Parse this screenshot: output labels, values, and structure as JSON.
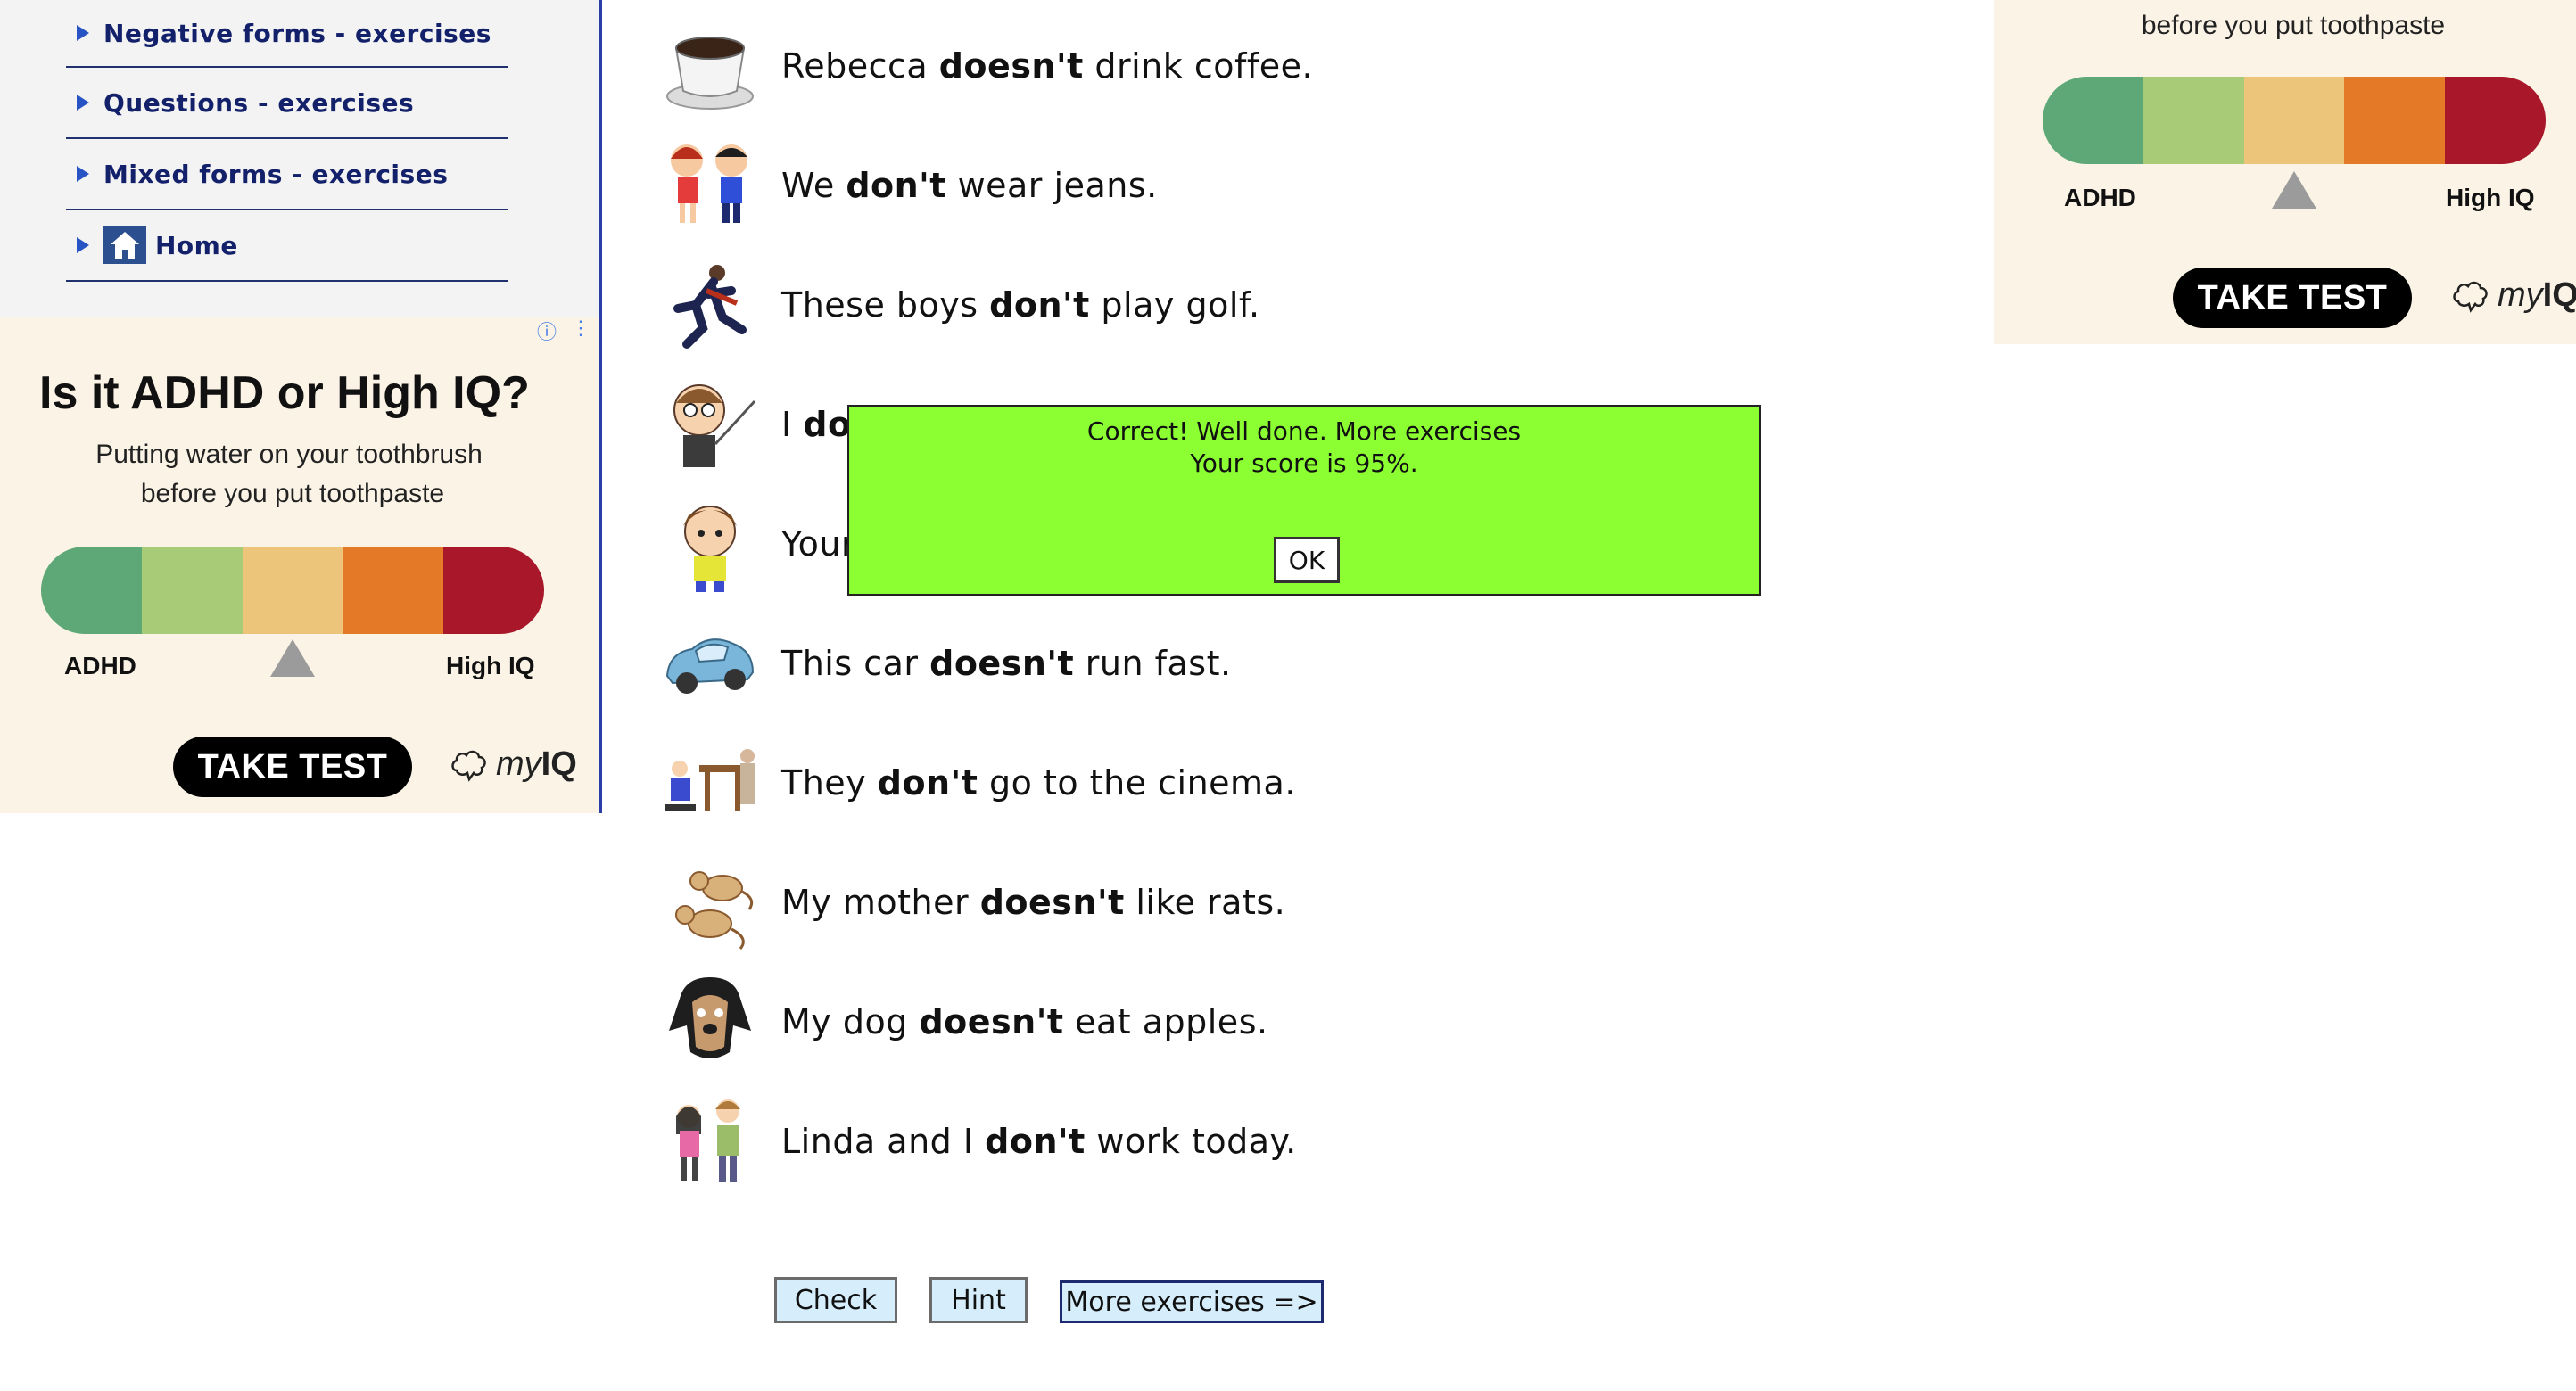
{
  "sidebar": {
    "items": [
      {
        "label": "Negative forms - exercises"
      },
      {
        "label": "Questions - exercises"
      },
      {
        "label": "Mixed forms - exercises"
      },
      {
        "label": "Home"
      }
    ]
  },
  "ad_left": {
    "title": "Is it ADHD or High IQ?",
    "subtitle_line1": "Putting water on your toothbrush",
    "subtitle_line2": "before you put toothpaste",
    "label_left": "ADHD",
    "label_right": "High IQ",
    "cta": "TAKE TEST",
    "brand_prefix": "my",
    "brand_suffix": "IQ",
    "info_icon": "ⓘ",
    "menu_icon": "⋮"
  },
  "ad_right": {
    "subtitle_line2": "before you put toothpaste",
    "label_left": "ADHD",
    "label_right": "High IQ",
    "cta": "TAKE TEST",
    "brand_prefix": "my",
    "brand_suffix": "IQ"
  },
  "gauge_colors": [
    "#5ea878",
    "#a8cb78",
    "#ecc57a",
    "#e47a27",
    "#a8182a"
  ],
  "exercises": [
    {
      "pre": "Rebecca ",
      "bold": "doesn't",
      "post": " drink coffee.",
      "icon": "coffee-cup-icon"
    },
    {
      "pre": "We ",
      "bold": "don't",
      "post": " wear jeans.",
      "icon": "children-icon"
    },
    {
      "pre": "These boys ",
      "bold": "don't",
      "post": " play golf.",
      "icon": "runners-icon"
    },
    {
      "pre": "I ",
      "bold": "do",
      "post": "",
      "icon": "teacher-icon"
    },
    {
      "pre": "Your",
      "bold": "",
      "post": "",
      "icon": "boy-icon"
    },
    {
      "pre": "This car ",
      "bold": "doesn't",
      "post": " run fast.",
      "icon": "car-icon"
    },
    {
      "pre": "They ",
      "bold": "don't",
      "post": " go to the cinema.",
      "icon": "cinema-icon"
    },
    {
      "pre": "My mother ",
      "bold": "doesn't",
      "post": " like rats.",
      "icon": "rats-icon"
    },
    {
      "pre": "My dog ",
      "bold": "doesn't",
      "post": " eat apples.",
      "icon": "dog-icon"
    },
    {
      "pre": "Linda and I ",
      "bold": "don't",
      "post": " work today.",
      "icon": "couple-icon"
    }
  ],
  "buttons": {
    "check": "Check",
    "hint": "Hint",
    "more": "More exercises =>"
  },
  "popup": {
    "line1": "Correct! Well done. More exercises",
    "line2": "Your score is 95%.",
    "ok": "OK"
  }
}
